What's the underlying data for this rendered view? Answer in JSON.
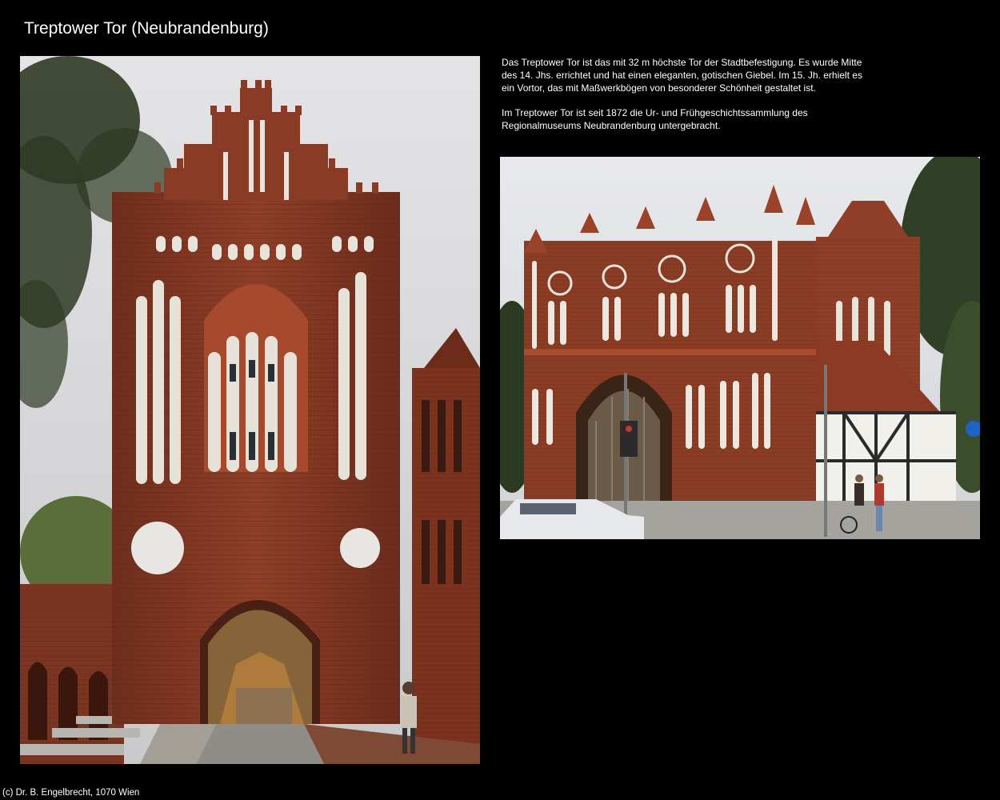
{
  "page": {
    "title": "Treptower Tor (Neubrandenburg)"
  },
  "description": {
    "paragraph_1": "Das Treptower Tor ist das mit 32 m höchste Tor der Stadtbefestigung. Es wurde Mitte des 14. Jhs. errichtet und hat einen eleganten, gotischen Giebel. Im 15. Jh. erhielt es ein Vortor, das mit Maßwerkbögen von besonderer Schönheit gestaltet ist.",
    "paragraph_2": "Im Treptower Tor ist seit 1872 die Ur- und Frühgeschichtssammlung des Regionalmuseums Neubrandenburg untergebracht."
  },
  "footer": {
    "copyright": "(c) Dr. B. Engelbrecht, 1070 Wien"
  },
  "colors": {
    "background": "#000000",
    "text": "#ffffff",
    "brick": "#8a3a24",
    "sky": "#dcdcdc"
  }
}
